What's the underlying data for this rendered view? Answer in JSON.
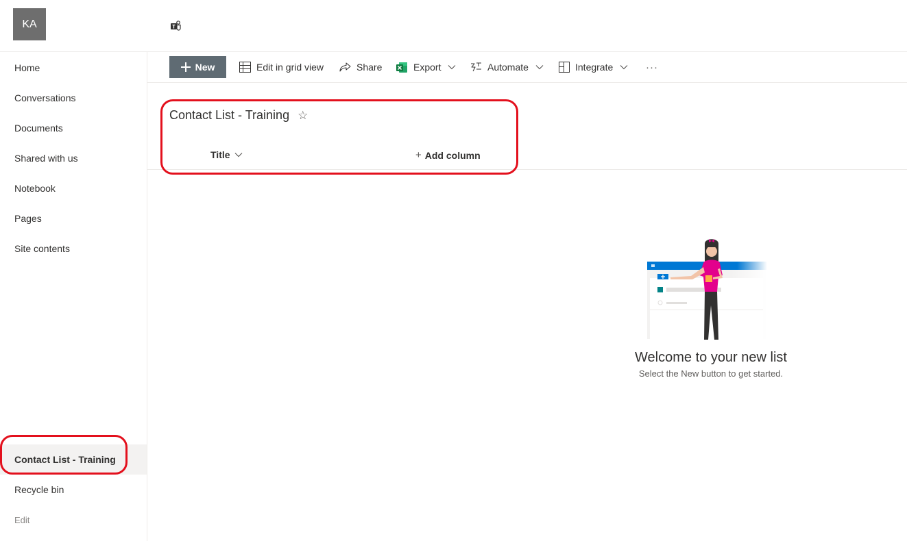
{
  "site": {
    "logo_initials": "KA",
    "teams_icon": "teams-icon"
  },
  "nav": {
    "items": [
      {
        "label": "Home"
      },
      {
        "label": "Conversations"
      },
      {
        "label": "Documents"
      },
      {
        "label": "Shared with us"
      },
      {
        "label": "Notebook"
      },
      {
        "label": "Pages"
      },
      {
        "label": "Site contents"
      }
    ],
    "bottom": [
      {
        "label": "Contact List - Training",
        "selected": true
      },
      {
        "label": "Recycle bin"
      }
    ],
    "edit_label": "Edit"
  },
  "commandbar": {
    "new_label": "New",
    "edit_grid_label": "Edit in grid view",
    "share_label": "Share",
    "export_label": "Export",
    "automate_label": "Automate",
    "integrate_label": "Integrate",
    "more_label": "···"
  },
  "list": {
    "title": "Contact List - Training",
    "star_icon": "☆",
    "columns": [
      {
        "label": "Title"
      }
    ],
    "add_column_label": "Add column"
  },
  "empty_state": {
    "title": "Welcome to your new list",
    "subtitle": "Select the New button to get started."
  },
  "colors": {
    "accent": "#0078d4",
    "new_button": "#5f6b73",
    "highlight": "#e3101d",
    "selected_nav": "#f3f2f1"
  }
}
